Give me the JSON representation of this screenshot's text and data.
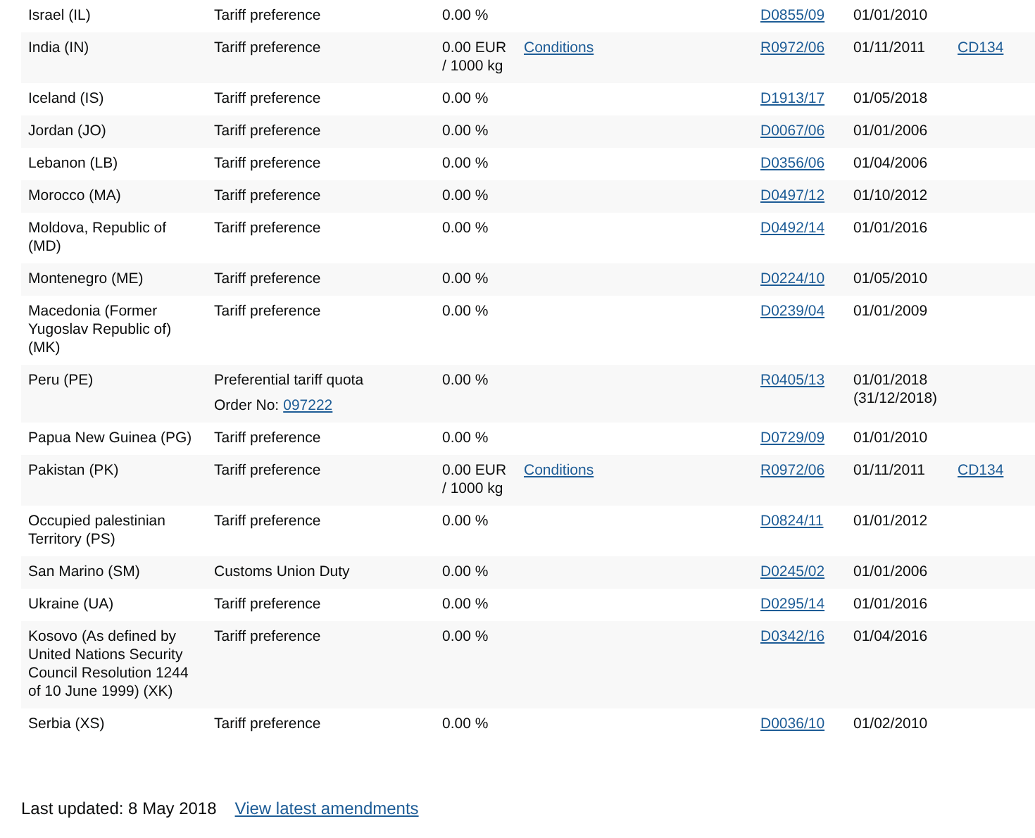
{
  "rows": [
    {
      "country": "Israel (IL)",
      "measure": "Tariff preference",
      "duty": "0.00 %",
      "regulation": "D0855/09",
      "start_date": "01/01/2010"
    },
    {
      "country": "India (IN)",
      "measure": "Tariff preference",
      "duty": "0.00 EUR / 1000 kg",
      "conditions": "Conditions",
      "regulation": "R0972/06",
      "start_date": "01/11/2011",
      "footnote": "CD134"
    },
    {
      "country": "Iceland (IS)",
      "measure": "Tariff preference",
      "duty": "0.00 %",
      "regulation": "D1913/17",
      "start_date": "01/05/2018"
    },
    {
      "country": "Jordan (JO)",
      "measure": "Tariff preference",
      "duty": "0.00 %",
      "regulation": "D0067/06",
      "start_date": "01/01/2006"
    },
    {
      "country": "Lebanon (LB)",
      "measure": "Tariff preference",
      "duty": "0.00 %",
      "regulation": "D0356/06",
      "start_date": "01/04/2006"
    },
    {
      "country": "Morocco (MA)",
      "measure": "Tariff preference",
      "duty": "0.00 %",
      "regulation": "D0497/12",
      "start_date": "01/10/2012"
    },
    {
      "country": "Moldova, Republic of (MD)",
      "measure": "Tariff preference",
      "duty": "0.00 %",
      "regulation": "D0492/14",
      "start_date": "01/01/2016"
    },
    {
      "country": "Montenegro (ME)",
      "measure": "Tariff preference",
      "duty": "0.00 %",
      "regulation": "D0224/10",
      "start_date": "01/05/2010"
    },
    {
      "country": "Macedonia (Former Yugoslav Republic of) (MK)",
      "measure": "Tariff preference",
      "duty": "0.00 %",
      "regulation": "D0239/04",
      "start_date": "01/01/2009"
    },
    {
      "country": "Peru (PE)",
      "measure": "Preferential tariff quota",
      "order_label": "Order No:",
      "order_number": "097222",
      "duty": "0.00 %",
      "regulation": "R0405/13",
      "start_date": "01/01/2018",
      "end_date": "(31/12/2018)"
    },
    {
      "country": "Papua New Guinea (PG)",
      "measure": "Tariff preference",
      "duty": "0.00 %",
      "regulation": "D0729/09",
      "start_date": "01/01/2010"
    },
    {
      "country": "Pakistan (PK)",
      "measure": "Tariff preference",
      "duty": "0.00 EUR / 1000 kg",
      "conditions": "Conditions",
      "regulation": "R0972/06",
      "start_date": "01/11/2011",
      "footnote": "CD134"
    },
    {
      "country": "Occupied palestinian Territory (PS)",
      "measure": "Tariff preference",
      "duty": "0.00 %",
      "regulation": "D0824/11",
      "start_date": "01/01/2012"
    },
    {
      "country": "San Marino (SM)",
      "measure": "Customs Union Duty",
      "duty": "0.00 %",
      "regulation": "D0245/02",
      "start_date": "01/01/2006"
    },
    {
      "country": "Ukraine (UA)",
      "measure": "Tariff preference",
      "duty": "0.00 %",
      "regulation": "D0295/14",
      "start_date": "01/01/2016"
    },
    {
      "country": "Kosovo (As defined by United Nations Security Council Resolution 1244 of 10 June 1999) (XK)",
      "measure": "Tariff preference",
      "duty": "0.00 %",
      "regulation": "D0342/16",
      "start_date": "01/04/2016"
    },
    {
      "country": "Serbia (XS)",
      "measure": "Tariff preference",
      "duty": "0.00 %",
      "regulation": "D0036/10",
      "start_date": "01/02/2010"
    }
  ],
  "footer": {
    "last_updated": "Last updated: 8 May 2018",
    "link": "View latest amendments"
  }
}
